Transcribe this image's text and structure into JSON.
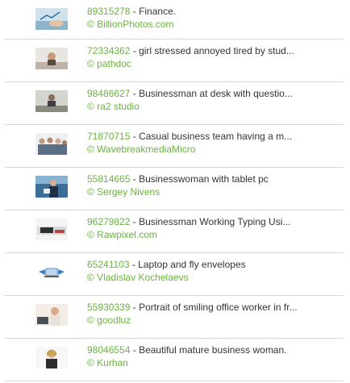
{
  "results": [
    {
      "id": "89315278",
      "sep": " - ",
      "title": "Finance.",
      "credit": "© BillionPhotos.com",
      "thumb": "hands-chart-thumbnail-icon"
    },
    {
      "id": "72334362",
      "sep": " - ",
      "title": "girl stressed annoyed tired by stud...",
      "credit": "© pathdoc",
      "thumb": "stressed-girl-thumbnail-icon"
    },
    {
      "id": "98486627",
      "sep": " - ",
      "title": "Businessman at desk with questio...",
      "credit": "© ra2 studio",
      "thumb": "businessman-desk-thumbnail-icon"
    },
    {
      "id": "71870715",
      "sep": " - ",
      "title": "Casual business team having a m...",
      "credit": "© WavebreakmediaMicro",
      "thumb": "team-meeting-thumbnail-icon"
    },
    {
      "id": "55814665",
      "sep": " - ",
      "title": "Businesswoman with tablet pc",
      "credit": "© Sergey Nivens",
      "thumb": "businesswoman-tablet-thumbnail-icon"
    },
    {
      "id": "96279822",
      "sep": " - ",
      "title": "Businessman Working Typing Usi...",
      "credit": "© Rawpixel.com",
      "thumb": "typing-laptop-thumbnail-icon"
    },
    {
      "id": "65241103",
      "sep": " - ",
      "title": "Laptop and fly envelopes",
      "credit": "© Vladislav Kochelaevs",
      "thumb": "laptop-envelopes-thumbnail-icon"
    },
    {
      "id": "55930339",
      "sep": " - ",
      "title": "Portrait of smiling office worker in fr...",
      "credit": "© goodluz",
      "thumb": "office-worker-thumbnail-icon"
    },
    {
      "id": "98046554",
      "sep": " - ",
      "title": "Beautiful mature business woman.",
      "credit": "© Kurhan",
      "thumb": "business-woman-thumbnail-icon"
    }
  ],
  "colors": {
    "link": "#6ab33e",
    "text": "#333333",
    "divider": "#d6d6d6"
  }
}
